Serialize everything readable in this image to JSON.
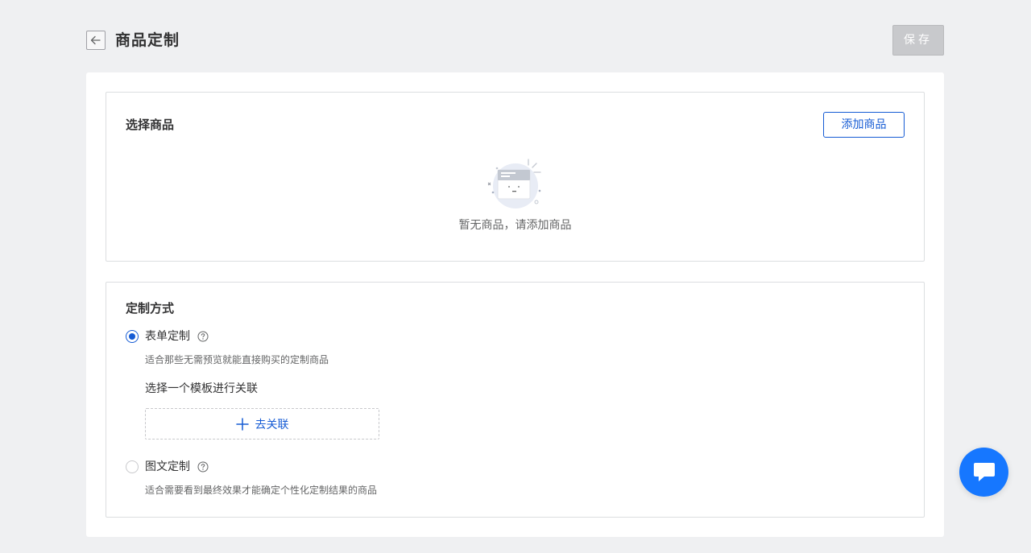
{
  "header": {
    "title": "商品定制",
    "save_label": "保存"
  },
  "goods_section": {
    "title": "选择商品",
    "add_button": "添加商品",
    "empty_text": "暂无商品，请添加商品"
  },
  "mode_section": {
    "title": "定制方式",
    "options": [
      {
        "label": "表单定制",
        "checked": true,
        "description": "适合那些无需预览就能直接购买的定制商品",
        "template_title": "选择一个模板进行关联",
        "link_label": "去关联"
      },
      {
        "label": "图文定制",
        "checked": false,
        "description": "适合需要看到最终效果才能确定个性化定制结果的商品"
      }
    ]
  },
  "colors": {
    "accent": "#155bd4",
    "chat": "#1677ff",
    "background": "#eff0f2"
  },
  "icons": {
    "back": "arrow-left-icon",
    "help": "question-circle-icon",
    "plus": "plus-icon",
    "chat": "chat-bubble-icon",
    "empty": "empty-goods-illustration"
  }
}
